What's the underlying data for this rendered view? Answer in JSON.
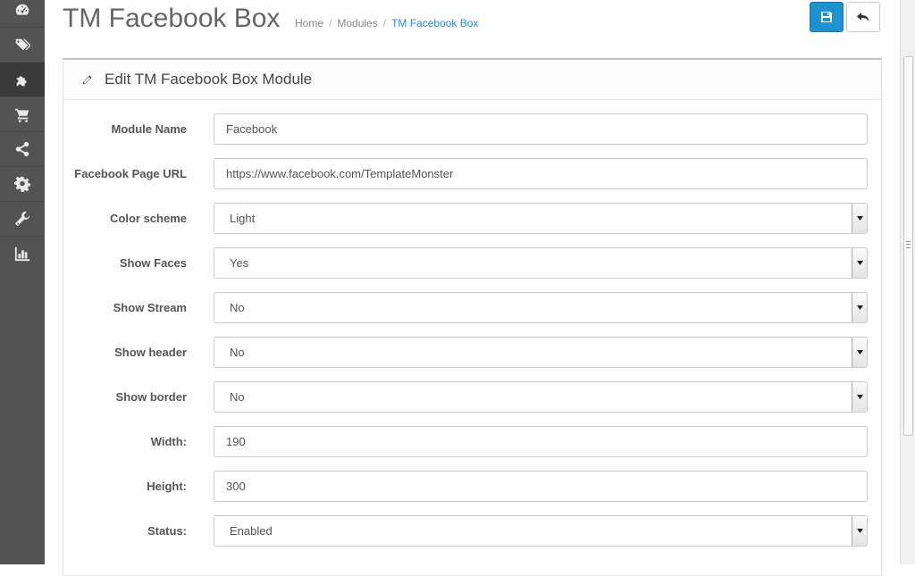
{
  "sidebar": {
    "items": [
      {
        "icon": "dashboard-icon",
        "active": false
      },
      {
        "icon": "tags-icon",
        "active": false
      },
      {
        "icon": "puzzle-icon",
        "active": true
      },
      {
        "icon": "shopping-cart-icon",
        "active": false
      },
      {
        "icon": "share-icon",
        "active": false
      },
      {
        "icon": "gear-icon",
        "active": false
      },
      {
        "icon": "wrench-icon",
        "active": false
      },
      {
        "icon": "bar-chart-icon",
        "active": false
      }
    ]
  },
  "header": {
    "title": "TM Facebook Box",
    "breadcrumb": [
      {
        "label": "Home"
      },
      {
        "label": "Modules"
      },
      {
        "label": "TM Facebook Box"
      }
    ],
    "separator": "/",
    "save_icon": "save-icon",
    "back_icon": "reply-icon"
  },
  "panel": {
    "title": "Edit TM Facebook Box Module",
    "icon": "pencil-icon"
  },
  "form": {
    "fields": [
      {
        "label": "Module Name",
        "value": "Facebook",
        "type": "text"
      },
      {
        "label": "Facebook Page URL",
        "value": "https://www.facebook.com/TemplateMonster",
        "type": "text"
      },
      {
        "label": "Color scheme",
        "value": "Light",
        "type": "select"
      },
      {
        "label": "Show Faces",
        "value": "Yes",
        "type": "select"
      },
      {
        "label": "Show Stream",
        "value": "No",
        "type": "select"
      },
      {
        "label": "Show header",
        "value": "No",
        "type": "select"
      },
      {
        "label": "Show border",
        "value": "No",
        "type": "select"
      },
      {
        "label": "Width:",
        "value": "190",
        "type": "text"
      },
      {
        "label": "Height:",
        "value": "300",
        "type": "text"
      },
      {
        "label": "Status:",
        "value": "Enabled",
        "type": "select"
      }
    ]
  },
  "colors": {
    "sidebar_bg": "#535353",
    "sidebar_active": "#3a3a3a",
    "primary": "#1e91cf",
    "title_text": "#666666"
  }
}
